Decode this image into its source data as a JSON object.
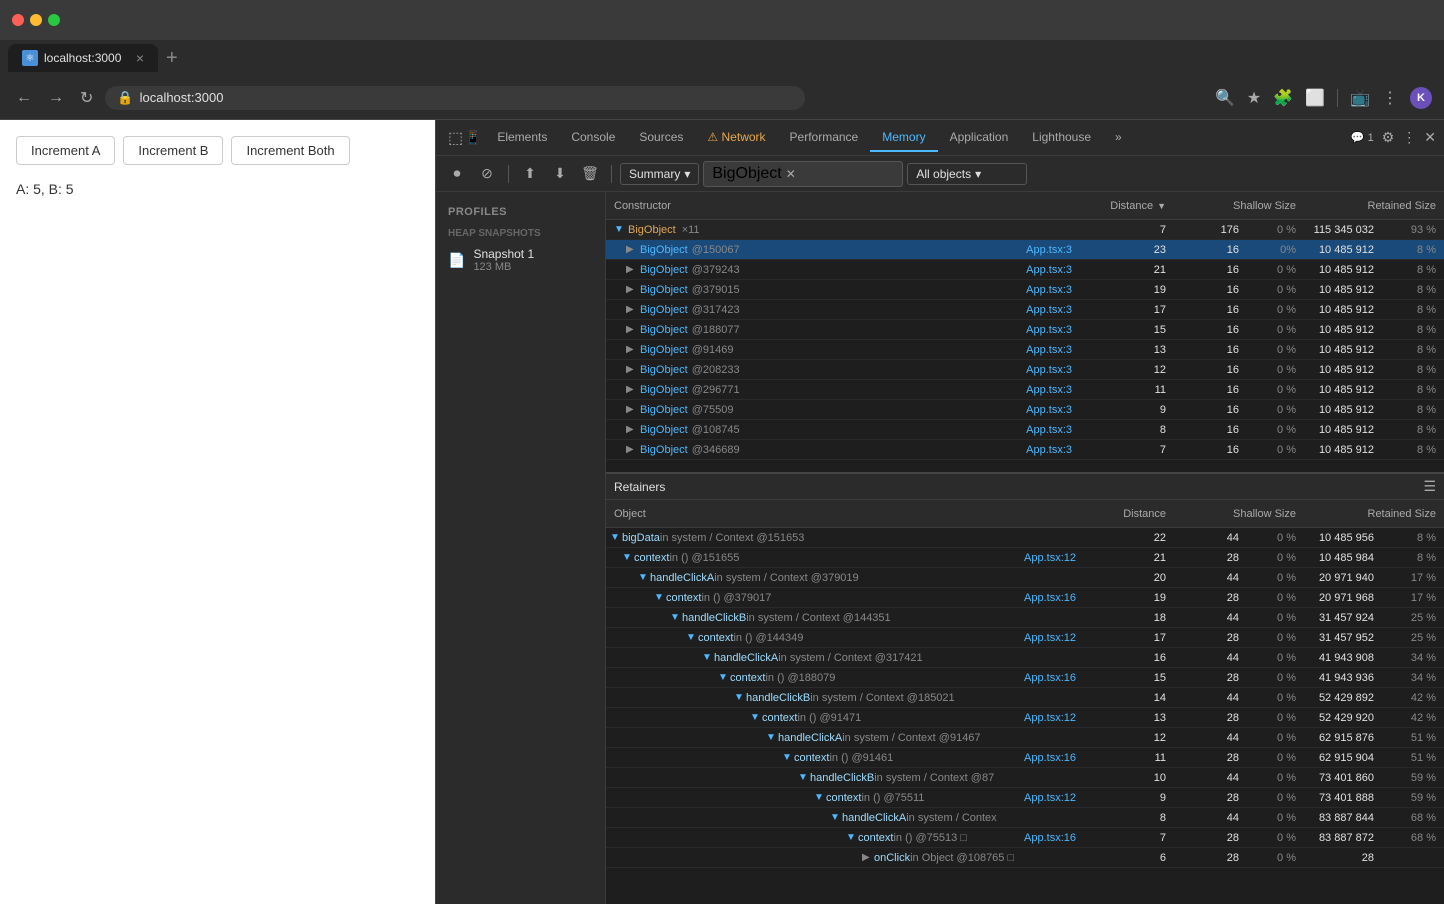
{
  "browser": {
    "title": "localhost:3000",
    "url": "localhost:3000",
    "tab_close": "×",
    "new_tab": "+",
    "nav_back": "←",
    "nav_forward": "→",
    "nav_refresh": "↻",
    "profile_initial": "K"
  },
  "app": {
    "buttons": [
      "Increment A",
      "Increment B",
      "Increment Both"
    ],
    "state": "A: 5, B: 5"
  },
  "devtools": {
    "tabs": [
      "Elements",
      "Console",
      "Sources",
      "Network",
      "Performance",
      "Memory",
      "Application",
      "Lighthouse"
    ],
    "active_tab": "Memory",
    "warning_tab": "Network",
    "badge_count": "1",
    "toolbar": {
      "summary_label": "Summary",
      "filter_value": "BigObject",
      "all_objects_label": "All objects"
    },
    "profiles": {
      "title": "Profiles",
      "section": "HEAP SNAPSHOTS",
      "items": [
        {
          "name": "Snapshot 1",
          "size": "123 MB"
        }
      ]
    },
    "heap_table": {
      "columns": [
        "Constructor",
        "Distance",
        "Shallow Size",
        "Retained Size"
      ],
      "rows": [
        {
          "name": "BigObject",
          "count": "×11",
          "distance": 7,
          "shallow_size": 176,
          "shallow_pct": "0 %",
          "retained_size": "115 345 032",
          "retained_pct": "93 %",
          "expanded": true,
          "indent": 0
        },
        {
          "name": "BigObject",
          "id": "@150067",
          "source": "App.tsx:3",
          "distance": 23,
          "shallow_size": 16,
          "shallow_pct": "0%",
          "retained_size": "10 485 912",
          "retained_pct": "8 %",
          "selected": true,
          "indent": 1
        },
        {
          "name": "BigObject",
          "id": "@379243",
          "source": "App.tsx:3",
          "distance": 21,
          "shallow_size": 16,
          "shallow_pct": "0 %",
          "retained_size": "10 485 912",
          "retained_pct": "8 %",
          "indent": 1
        },
        {
          "name": "BigObject",
          "id": "@379015",
          "source": "App.tsx:3",
          "distance": 19,
          "shallow_size": 16,
          "shallow_pct": "0 %",
          "retained_size": "10 485 912",
          "retained_pct": "8 %",
          "indent": 1
        },
        {
          "name": "BigObject",
          "id": "@317423",
          "source": "App.tsx:3",
          "distance": 17,
          "shallow_size": 16,
          "shallow_pct": "0 %",
          "retained_size": "10 485 912",
          "retained_pct": "8 %",
          "indent": 1
        },
        {
          "name": "BigObject",
          "id": "@188077",
          "source": "App.tsx:3",
          "distance": 15,
          "shallow_size": 16,
          "shallow_pct": "0 %",
          "retained_size": "10 485 912",
          "retained_pct": "8 %",
          "indent": 1
        },
        {
          "name": "BigObject",
          "id": "@91469",
          "source": "App.tsx:3",
          "distance": 13,
          "shallow_size": 16,
          "shallow_pct": "0 %",
          "retained_size": "10 485 912",
          "retained_pct": "8 %",
          "indent": 1
        },
        {
          "name": "BigObject",
          "id": "@208233",
          "source": "App.tsx:3",
          "distance": 12,
          "shallow_size": 16,
          "shallow_pct": "0 %",
          "retained_size": "10 485 912",
          "retained_pct": "8 %",
          "indent": 1
        },
        {
          "name": "BigObject",
          "id": "@296771",
          "source": "App.tsx:3",
          "distance": 11,
          "shallow_size": 16,
          "shallow_pct": "0 %",
          "retained_size": "10 485 912",
          "retained_pct": "8 %",
          "indent": 1
        },
        {
          "name": "BigObject",
          "id": "@75509",
          "source": "App.tsx:3",
          "distance": 9,
          "shallow_size": 16,
          "shallow_pct": "0 %",
          "retained_size": "10 485 912",
          "retained_pct": "8 %",
          "indent": 1
        },
        {
          "name": "BigObject",
          "id": "@108745",
          "source": "App.tsx:3",
          "distance": 8,
          "shallow_size": 16,
          "shallow_pct": "0 %",
          "retained_size": "10 485 912",
          "retained_pct": "8 %",
          "indent": 1
        },
        {
          "name": "BigObject",
          "id": "@346689",
          "source": "App.tsx:3",
          "distance": 7,
          "shallow_size": 16,
          "shallow_pct": "0 %",
          "retained_size": "10 485 912",
          "retained_pct": "8 %",
          "indent": 1
        }
      ]
    },
    "retainers": {
      "title": "Retainers",
      "columns": [
        "Object",
        "Distance",
        "Shallow Size",
        "Retained Size"
      ],
      "rows": [
        {
          "text": "bigData in system / Context @151653",
          "var": "bigData",
          "context": " in system / Context @151653",
          "distance": 22,
          "ss": 44,
          "ss_pct": "0 %",
          "rs": "10 485 956",
          "rs_pct": "8 %",
          "indent": 0,
          "source": null
        },
        {
          "text": "context in () @151655",
          "var": "context",
          "context": " in () @151655",
          "distance": 21,
          "ss": 28,
          "ss_pct": "0 %",
          "rs": "10 485 984",
          "rs_pct": "8 %",
          "indent": 1,
          "source": "App.tsx:12"
        },
        {
          "text": "handleClickA in system / Context @379019",
          "var": "handleClickA",
          "context": " in system / Context @379019",
          "distance": 20,
          "ss": 44,
          "ss_pct": "0 %",
          "rs": "20 971 940",
          "rs_pct": "17 %",
          "indent": 2,
          "source": null
        },
        {
          "text": "context in () @379017",
          "var": "context",
          "context": " in () @379017",
          "distance": 19,
          "ss": 28,
          "ss_pct": "0 %",
          "rs": "20 971 968",
          "rs_pct": "17 %",
          "indent": 3,
          "source": "App.tsx:16"
        },
        {
          "text": "handleClickB in system / Context @144351",
          "var": "handleClickB",
          "context": " in system / Context @144351",
          "distance": 18,
          "ss": 44,
          "ss_pct": "0 %",
          "rs": "31 457 924",
          "rs_pct": "25 %",
          "indent": 4,
          "source": null
        },
        {
          "text": "context in () @144349",
          "var": "context",
          "context": " in () @144349",
          "distance": 17,
          "ss": 28,
          "ss_pct": "0 %",
          "rs": "31 457 952",
          "rs_pct": "25 %",
          "indent": 5,
          "source": "App.tsx:12"
        },
        {
          "text": "handleClickA in system / Context @317421",
          "var": "handleClickA",
          "context": " in system / Context @317421",
          "distance": 16,
          "ss": 44,
          "ss_pct": "0 %",
          "rs": "41 943 908",
          "rs_pct": "34 %",
          "indent": 6,
          "source": null
        },
        {
          "text": "context in () @188079",
          "var": "context",
          "context": " in () @188079",
          "distance": 15,
          "ss": 28,
          "ss_pct": "0 %",
          "rs": "41 943 936",
          "rs_pct": "34 %",
          "indent": 7,
          "source": "App.tsx:16"
        },
        {
          "text": "handleClickB in system / Context @185021",
          "var": "handleClickB",
          "context": " in system / Context @185021",
          "distance": 14,
          "ss": 44,
          "ss_pct": "0 %",
          "rs": "52 429 892",
          "rs_pct": "42 %",
          "indent": 8,
          "source": null
        },
        {
          "text": "context in () @91471",
          "var": "context",
          "context": " in () @91471",
          "distance": 13,
          "ss": 28,
          "ss_pct": "0 %",
          "rs": "52 429 920",
          "rs_pct": "42 %",
          "indent": 9,
          "source": "App.tsx:12"
        },
        {
          "text": "handleClickA in system / Context @91467",
          "var": "handleClickA",
          "context": " in system / Context @91467",
          "distance": 12,
          "ss": 44,
          "ss_pct": "0 %",
          "rs": "62 915 876",
          "rs_pct": "51 %",
          "indent": 10,
          "source": null
        },
        {
          "text": "context in () @91461",
          "var": "context",
          "context": " in () @91461",
          "distance": 11,
          "ss": 28,
          "ss_pct": "0 %",
          "rs": "62 915 904",
          "rs_pct": "51 %",
          "indent": 10,
          "source": "App.tsx:16"
        },
        {
          "text": "handleClickB in system / Context @87",
          "var": "handleClickB",
          "context": " in system / Context @87",
          "distance": 10,
          "ss": 44,
          "ss_pct": "0 %",
          "rs": "73 401 860",
          "rs_pct": "59 %",
          "indent": 10,
          "source": null
        },
        {
          "text": "context in () @75511",
          "var": "context",
          "context": " in () @75511",
          "distance": 9,
          "ss": 28,
          "ss_pct": "0 %",
          "rs": "73 401 888",
          "rs_pct": "59 %",
          "indent": 10,
          "source": "App.tsx:12"
        },
        {
          "text": "handleClickA in system / Contex",
          "var": "handleClickA",
          "context": " in system / Contex",
          "distance": 8,
          "ss": 44,
          "ss_pct": "0 %",
          "rs": "83 887 844",
          "rs_pct": "68 %",
          "indent": 10,
          "source": null
        },
        {
          "text": "context in () @75513",
          "var": "context",
          "context": " in () @75513 □",
          "distance": 7,
          "ss": 28,
          "ss_pct": "0 %",
          "rs": "83 887 872",
          "rs_pct": "68 %",
          "indent": 10,
          "source": "App.tsx:16"
        },
        {
          "text": "onClick in Object @108765",
          "var": "onClick",
          "context": " in Object @108765 □",
          "distance": 6,
          "ss": 28,
          "ss_pct": "0 %",
          "rs": 28,
          "rs_pct": "",
          "indent": 10,
          "source": null
        }
      ]
    }
  }
}
